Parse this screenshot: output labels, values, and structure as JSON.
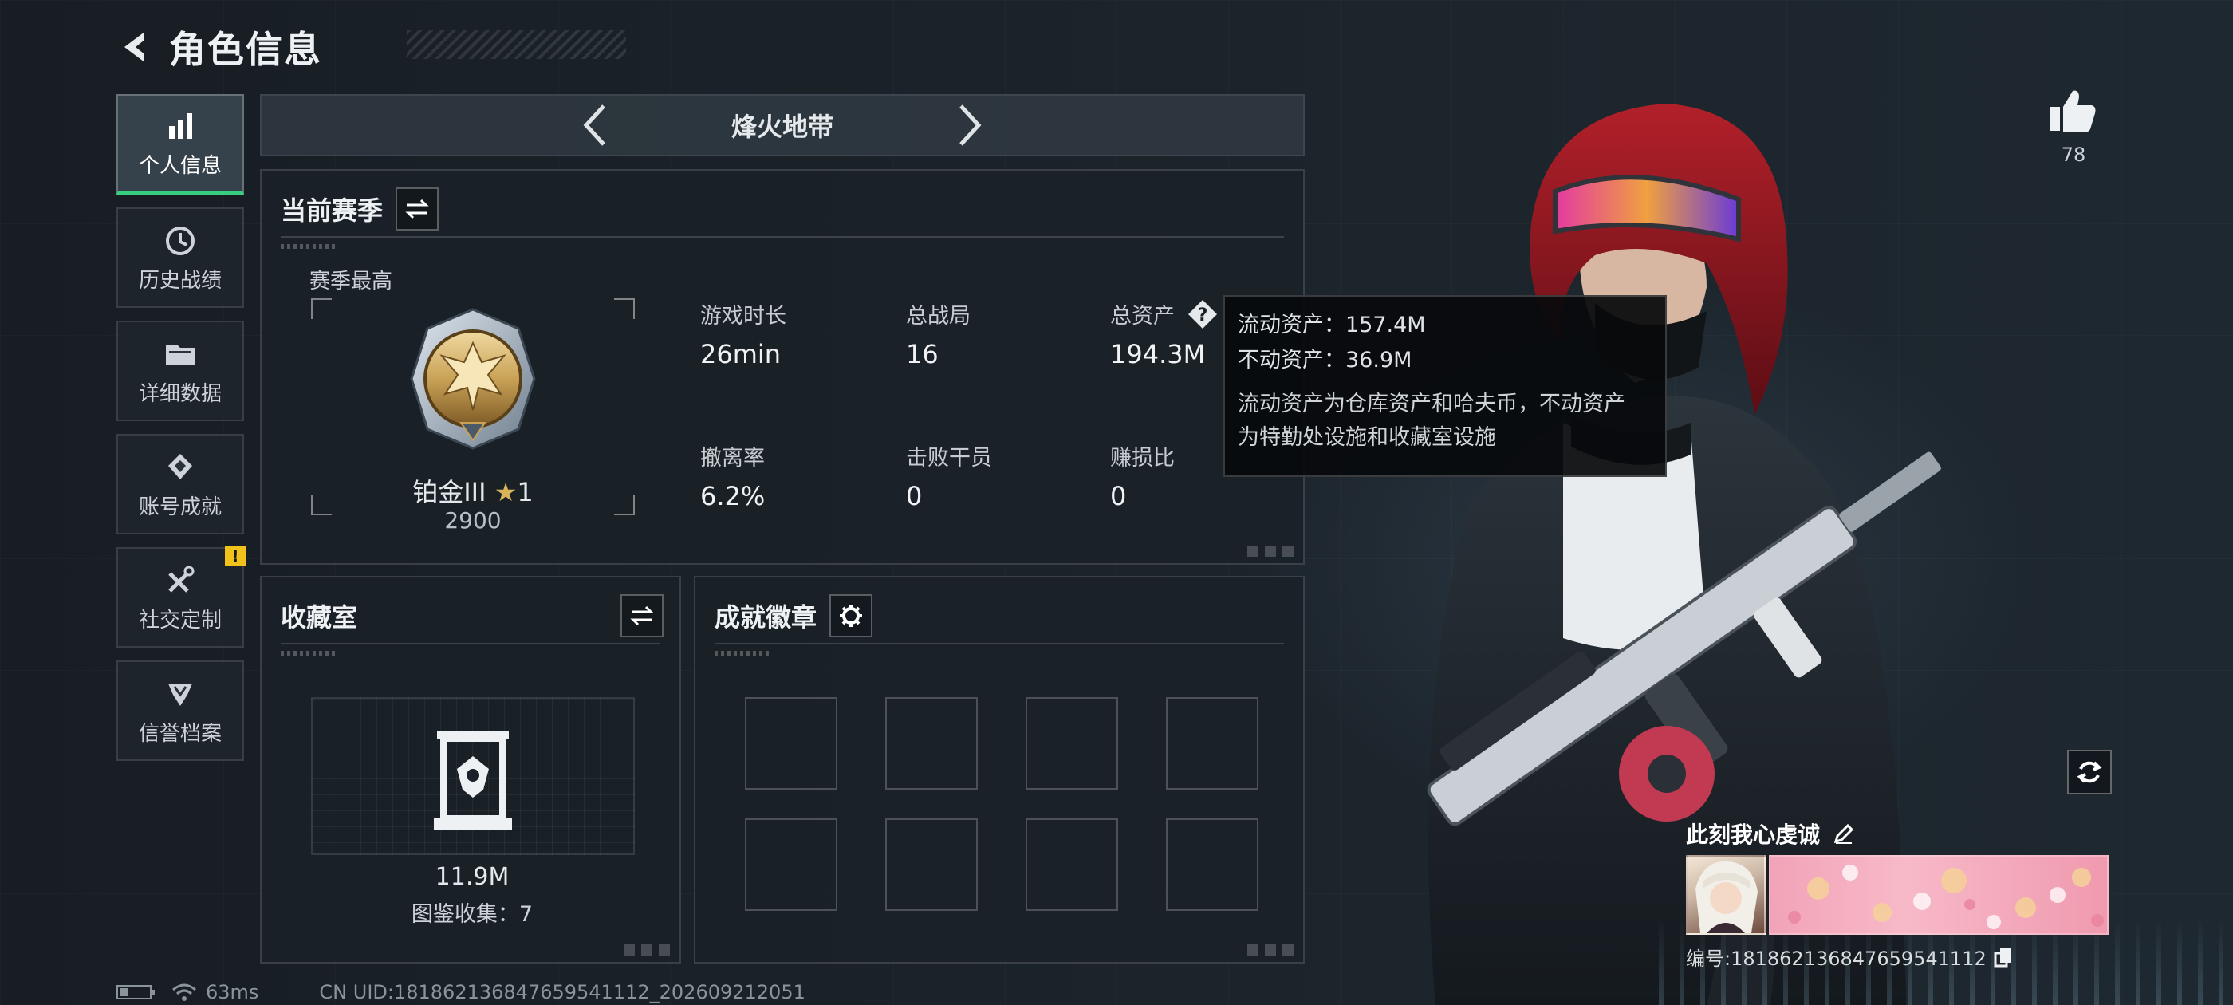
{
  "header": {
    "title": "角色信息"
  },
  "sidebar": {
    "items": [
      {
        "label": "个人信息",
        "icon": "bar-chart-icon",
        "active": true
      },
      {
        "label": "历史战绩",
        "icon": "history-icon"
      },
      {
        "label": "详细数据",
        "icon": "folder-icon"
      },
      {
        "label": "账号成就",
        "icon": "achievement-icon"
      },
      {
        "label": "社交定制",
        "icon": "tools-icon",
        "badge": "!"
      },
      {
        "label": "信誉档案",
        "icon": "credit-icon"
      }
    ]
  },
  "mode": {
    "label": "烽火地带"
  },
  "season": {
    "title": "当前赛季",
    "best_label": "赛季最高",
    "rank_name": "铂金III",
    "rank_stars": "1",
    "rank_score": "2900",
    "stats": [
      {
        "label": "游戏时长",
        "value": "26min"
      },
      {
        "label": "总战局",
        "value": "16"
      },
      {
        "label": "总资产",
        "value": "194.3M"
      },
      {
        "label": "撤离率",
        "value": "6.2%"
      },
      {
        "label": "击败干员",
        "value": "0"
      },
      {
        "label": "赚损比",
        "value": "0"
      }
    ]
  },
  "tooltip": {
    "liquid": "流动资产：157.4M",
    "fixed": "不动资产：36.9M",
    "desc_line1": "流动资产为仓库资产和哈夫币，不动资产",
    "desc_line2": "为特勤处设施和收藏室设施"
  },
  "collection": {
    "title": "收藏室",
    "value": "11.9M",
    "count": "图鉴收集：7"
  },
  "achievements": {
    "title": "成就徽章"
  },
  "status_bar": {
    "ping": "63ms",
    "uid_line": "CN UID:18186213684765954111​2_202609212051"
  },
  "likes": {
    "count": "78"
  },
  "player": {
    "name": "此刻我心虔诚",
    "uid": "编号:18186213684765954111​2"
  },
  "colors": {
    "accent_green": "#36d07e",
    "warning_yellow": "#f2c21a",
    "rank_gold": "#c9a257"
  }
}
